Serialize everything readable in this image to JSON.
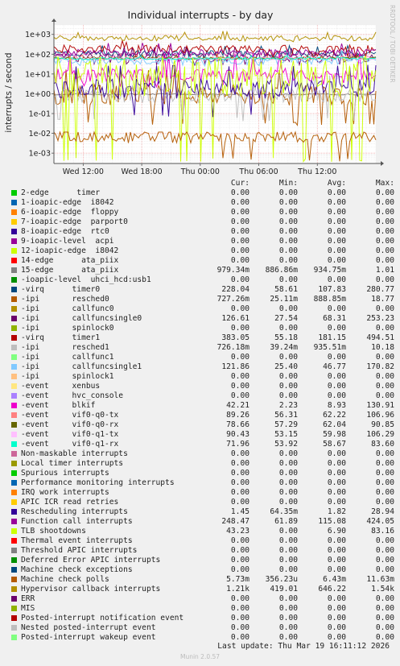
{
  "chart_data": {
    "type": "line",
    "title": "Individual interrupts - by day",
    "ylabel": "interrupts / second",
    "side_label": "RRDTOOL / TOBI OETIKER",
    "y_scale": "log",
    "ylim": [
      0.0003,
      3000
    ],
    "y_ticks": [
      {
        "label": "1e+03",
        "value": 1000
      },
      {
        "label": "1e+02",
        "value": 100
      },
      {
        "label": "1e+01",
        "value": 10
      },
      {
        "label": "1e+00",
        "value": 1
      },
      {
        "label": "1e-01",
        "value": 0.1
      },
      {
        "label": "1e-02",
        "value": 0.01
      },
      {
        "label": "1e-03",
        "value": 0.001
      }
    ],
    "xlim": [
      0,
      33
    ],
    "x_ticks": [
      {
        "label": "Wed 12:00",
        "value": 3
      },
      {
        "label": "Wed 18:00",
        "value": 9
      },
      {
        "label": "Thu 00:00",
        "value": 15
      },
      {
        "label": "Thu 06:00",
        "value": 21
      },
      {
        "label": "Thu 12:00",
        "value": 27
      }
    ],
    "x_unit": "hours since Wed 09:00",
    "grid": true,
    "columns": [
      "Cur:",
      "Min:",
      "Avg:",
      "Max:"
    ],
    "series": [
      {
        "name": "2-edge      timer",
        "color": "#00cc00",
        "cur": "0.00",
        "min": "0.00",
        "avg": "0.00",
        "max": "0.00"
      },
      {
        "name": "1-ioapic-edge  i8042",
        "color": "#0066b3",
        "cur": "0.00",
        "min": "0.00",
        "avg": "0.00",
        "max": "0.00"
      },
      {
        "name": "6-ioapic-edge  floppy",
        "color": "#ff8000",
        "cur": "0.00",
        "min": "0.00",
        "avg": "0.00",
        "max": "0.00"
      },
      {
        "name": "7-ioapic-edge  parport0",
        "color": "#ffcc00",
        "cur": "0.00",
        "min": "0.00",
        "avg": "0.00",
        "max": "0.00"
      },
      {
        "name": "8-ioapic-edge  rtc0",
        "color": "#330099",
        "cur": "0.00",
        "min": "0.00",
        "avg": "0.00",
        "max": "0.00"
      },
      {
        "name": "9-ioapic-level  acpi",
        "color": "#990099",
        "cur": "0.00",
        "min": "0.00",
        "avg": "0.00",
        "max": "0.00"
      },
      {
        "name": "12-ioapic-edge  i8042",
        "color": "#ccff00",
        "cur": "0.00",
        "min": "0.00",
        "avg": "0.00",
        "max": "0.00"
      },
      {
        "name": "14-edge      ata_piix",
        "color": "#ff0000",
        "cur": "0.00",
        "min": "0.00",
        "avg": "0.00",
        "max": "0.00"
      },
      {
        "name": "15-edge      ata_piix",
        "color": "#808080",
        "cur": "979.34m",
        "min": "886.86m",
        "avg": "934.75m",
        "max": "1.01"
      },
      {
        "name": "-ioapic-level  uhci_hcd:usb1",
        "color": "#008f00",
        "cur": "0.00",
        "min": "0.00",
        "avg": "0.00",
        "max": "0.00"
      },
      {
        "name": "-virq      timer0",
        "color": "#00487d",
        "cur": "228.04",
        "min": "58.61",
        "avg": "107.83",
        "max": "280.77"
      },
      {
        "name": "-ipi       resched0",
        "color": "#b35a00",
        "cur": "727.26m",
        "min": "25.11m",
        "avg": "888.85m",
        "max": "18.77"
      },
      {
        "name": "-ipi       callfunc0",
        "color": "#b38f00",
        "cur": "0.00",
        "min": "0.00",
        "avg": "0.00",
        "max": "0.00"
      },
      {
        "name": "-ipi       callfuncsingle0",
        "color": "#6b006b",
        "cur": "126.61",
        "min": "27.54",
        "avg": "68.31",
        "max": "253.23"
      },
      {
        "name": "-ipi       spinlock0",
        "color": "#8fb300",
        "cur": "0.00",
        "min": "0.00",
        "avg": "0.00",
        "max": "0.00"
      },
      {
        "name": "-virq      timer1",
        "color": "#b30000",
        "cur": "383.05",
        "min": "55.18",
        "avg": "181.15",
        "max": "494.51"
      },
      {
        "name": "-ipi       resched1",
        "color": "#bebebe",
        "cur": "726.18m",
        "min": "39.24m",
        "avg": "935.51m",
        "max": "10.18"
      },
      {
        "name": "-ipi       callfunc1",
        "color": "#80ff80",
        "cur": "0.00",
        "min": "0.00",
        "avg": "0.00",
        "max": "0.00"
      },
      {
        "name": "-ipi       callfuncsingle1",
        "color": "#80c9ff",
        "cur": "121.86",
        "min": "25.40",
        "avg": "46.77",
        "max": "170.82"
      },
      {
        "name": "-ipi       spinlock1",
        "color": "#ffc080",
        "cur": "0.00",
        "min": "0.00",
        "avg": "0.00",
        "max": "0.00"
      },
      {
        "name": "-event     xenbus",
        "color": "#ffe680",
        "cur": "0.00",
        "min": "0.00",
        "avg": "0.00",
        "max": "0.00"
      },
      {
        "name": "-event     hvc_console",
        "color": "#aa80ff",
        "cur": "0.00",
        "min": "0.00",
        "avg": "0.00",
        "max": "0.00"
      },
      {
        "name": "-event     blkif",
        "color": "#ee00cc",
        "cur": "42.21",
        "min": "2.23",
        "avg": "8.93",
        "max": "130.91"
      },
      {
        "name": "-event     vif0-q0-tx",
        "color": "#ff8080",
        "cur": "89.26",
        "min": "56.31",
        "avg": "62.22",
        "max": "106.96"
      },
      {
        "name": "-event     vif0-q0-rx",
        "color": "#666600",
        "cur": "78.66",
        "min": "57.29",
        "avg": "62.04",
        "max": "90.85"
      },
      {
        "name": "-event     vif0-q1-tx",
        "color": "#ffbfff",
        "cur": "90.43",
        "min": "53.15",
        "avg": "59.98",
        "max": "106.29"
      },
      {
        "name": "-event     vif0-q1-rx",
        "color": "#00ffcc",
        "cur": "71.96",
        "min": "53.92",
        "avg": "58.67",
        "max": "83.60"
      },
      {
        "name": "Non-maskable interrupts",
        "color": "#cc6699",
        "cur": "0.00",
        "min": "0.00",
        "avg": "0.00",
        "max": "0.00"
      },
      {
        "name": "Local timer interrupts",
        "color": "#999900",
        "cur": "0.00",
        "min": "0.00",
        "avg": "0.00",
        "max": "0.00"
      },
      {
        "name": "Spurious interrupts",
        "color": "#00cc00",
        "cur": "0.00",
        "min": "0.00",
        "avg": "0.00",
        "max": "0.00"
      },
      {
        "name": "Performance monitoring interrupts",
        "color": "#0066b3",
        "cur": "0.00",
        "min": "0.00",
        "avg": "0.00",
        "max": "0.00"
      },
      {
        "name": "IRQ work interrupts",
        "color": "#ff8000",
        "cur": "0.00",
        "min": "0.00",
        "avg": "0.00",
        "max": "0.00"
      },
      {
        "name": "APIC ICR read retries",
        "color": "#ffcc00",
        "cur": "0.00",
        "min": "0.00",
        "avg": "0.00",
        "max": "0.00"
      },
      {
        "name": "Rescheduling interrupts",
        "color": "#330099",
        "cur": "1.45",
        "min": "64.35m",
        "avg": "1.82",
        "max": "28.94"
      },
      {
        "name": "Function call interrupts",
        "color": "#990099",
        "cur": "248.47",
        "min": "61.89",
        "avg": "115.08",
        "max": "424.05"
      },
      {
        "name": "TLB shootdowns",
        "color": "#ccff00",
        "cur": "43.23",
        "min": "0.00",
        "avg": "6.90",
        "max": "83.16"
      },
      {
        "name": "Thermal event interrupts",
        "color": "#ff0000",
        "cur": "0.00",
        "min": "0.00",
        "avg": "0.00",
        "max": "0.00"
      },
      {
        "name": "Threshold APIC interrupts",
        "color": "#808080",
        "cur": "0.00",
        "min": "0.00",
        "avg": "0.00",
        "max": "0.00"
      },
      {
        "name": "Deferred Error APIC interrupts",
        "color": "#008f00",
        "cur": "0.00",
        "min": "0.00",
        "avg": "0.00",
        "max": "0.00"
      },
      {
        "name": "Machine check exceptions",
        "color": "#00487d",
        "cur": "0.00",
        "min": "0.00",
        "avg": "0.00",
        "max": "0.00"
      },
      {
        "name": "Machine check polls",
        "color": "#b35a00",
        "cur": "5.73m",
        "min": "356.23u",
        "avg": "6.43m",
        "max": "11.63m"
      },
      {
        "name": "Hypervisor callback interrupts",
        "color": "#b38f00",
        "cur": "1.21k",
        "min": "419.01",
        "avg": "646.22",
        "max": "1.54k"
      },
      {
        "name": "ERR",
        "color": "#6b006b",
        "cur": "0.00",
        "min": "0.00",
        "avg": "0.00",
        "max": "0.00"
      },
      {
        "name": "MIS",
        "color": "#8fb300",
        "cur": "0.00",
        "min": "0.00",
        "avg": "0.00",
        "max": "0.00"
      },
      {
        "name": "Posted-interrupt notification event",
        "color": "#b30000",
        "cur": "0.00",
        "min": "0.00",
        "avg": "0.00",
        "max": "0.00"
      },
      {
        "name": "Nested posted-interrupt event",
        "color": "#bebebe",
        "cur": "0.00",
        "min": "0.00",
        "avg": "0.00",
        "max": "0.00"
      },
      {
        "name": "Posted-interrupt wakeup event",
        "color": "#80ff80",
        "cur": "0.00",
        "min": "0.00",
        "avg": "0.00",
        "max": "0.00"
      }
    ]
  },
  "last_update": "Last update: Thu Mar 19 16:11:12 2026",
  "footer": "Munin 2.0.57"
}
